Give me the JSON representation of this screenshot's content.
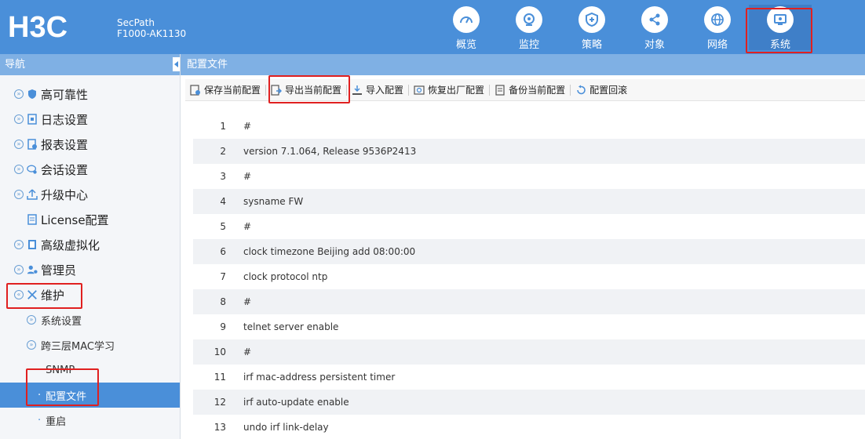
{
  "header": {
    "brand": "H3C",
    "product_line1": "SecPath",
    "product_line2": "F1000-AK1130",
    "tabs": [
      {
        "label": "概览",
        "icon": "dashboard-icon"
      },
      {
        "label": "监控",
        "icon": "monitor-icon"
      },
      {
        "label": "策略",
        "icon": "shield-icon"
      },
      {
        "label": "对象",
        "icon": "share-icon"
      },
      {
        "label": "网络",
        "icon": "globe-icon"
      },
      {
        "label": "系统",
        "icon": "system-icon"
      }
    ],
    "active_tab": "系统"
  },
  "sidebar": {
    "title": "导航",
    "items": [
      {
        "label": "高可靠性",
        "icon": "shield-icon"
      },
      {
        "label": "日志设置",
        "icon": "log-icon"
      },
      {
        "label": "报表设置",
        "icon": "report-icon"
      },
      {
        "label": "会话设置",
        "icon": "session-icon"
      },
      {
        "label": "升级中心",
        "icon": "upload-icon"
      },
      {
        "label": "License配置",
        "icon": "license-icon"
      },
      {
        "label": "高级虚拟化",
        "icon": "virtual-icon"
      },
      {
        "label": "管理员",
        "icon": "admin-icon"
      },
      {
        "label": "维护",
        "icon": "tools-icon"
      }
    ],
    "subitems": [
      {
        "label": "系统设置"
      },
      {
        "label": "跨三层MAC学习"
      },
      {
        "label": "SNMP"
      },
      {
        "label": "配置文件"
      },
      {
        "label": "重启"
      }
    ],
    "selected": "配置文件"
  },
  "content": {
    "title": "配置文件",
    "toolbar": [
      {
        "label": "保存当前配置",
        "icon": "save-config-icon"
      },
      {
        "label": "导出当前配置",
        "icon": "export-icon"
      },
      {
        "label": "导入配置",
        "icon": "import-icon"
      },
      {
        "label": "恢复出厂配置",
        "icon": "restore-icon"
      },
      {
        "label": "备份当前配置",
        "icon": "backup-icon"
      },
      {
        "label": "配置回滚",
        "icon": "rollback-icon"
      }
    ],
    "lines": [
      {
        "n": "1",
        "text": "#"
      },
      {
        "n": "2",
        "text": "version 7.1.064, Release 9536P2413"
      },
      {
        "n": "3",
        "text": "#"
      },
      {
        "n": "4",
        "text": "sysname FW"
      },
      {
        "n": "5",
        "text": "#"
      },
      {
        "n": "6",
        "text": "clock timezone Beijing add 08:00:00"
      },
      {
        "n": "7",
        "text": "clock protocol ntp"
      },
      {
        "n": "8",
        "text": "#"
      },
      {
        "n": "9",
        "text": "telnet server enable"
      },
      {
        "n": "10",
        "text": "#"
      },
      {
        "n": "11",
        "text": "irf mac-address persistent timer"
      },
      {
        "n": "12",
        "text": "irf auto-update enable"
      },
      {
        "n": "13",
        "text": "undo irf link-delay"
      }
    ]
  },
  "colors": {
    "header_bg": "#4a8fd9",
    "subheader_bg": "#7fb0e4",
    "highlight": "#e02020",
    "selected_bg": "#4a8fd9"
  }
}
